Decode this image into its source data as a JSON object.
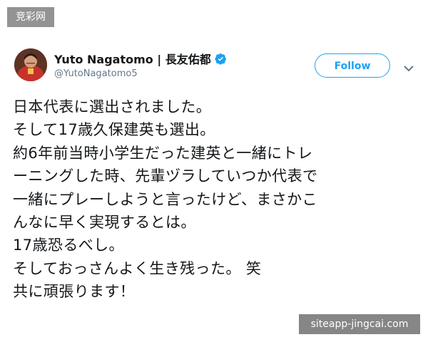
{
  "watermark_top": "竞彩网",
  "watermark_bottom": "siteapp-jingcai.com",
  "user": {
    "display_name": "Yuto Nagatomo | 長友佑都",
    "handle": "@YutoNagatomo5",
    "verified": true
  },
  "follow_label": "Follow",
  "colors": {
    "accent": "#1da1f2",
    "text": "#14171a",
    "secondary_text": "#657786"
  },
  "tweet": {
    "lines": [
      "日本代表に選出されました。",
      "そして17歳久保建英も選出。",
      "約6年前当時小学生だった建英と一緒にトレ",
      "ーニングした時、先輩ヅラしていつか代表で",
      "一緒にプレーしようと言ったけど、まさかこ",
      "んなに早く実現するとは。",
      "17歳恐るべし。",
      "そしておっさんよく生き残った。 笑",
      "共に頑張ります！"
    ]
  },
  "icons": {
    "avatar": "avatar",
    "verified": "verified-badge-icon",
    "menu": "chevron-down-icon"
  }
}
